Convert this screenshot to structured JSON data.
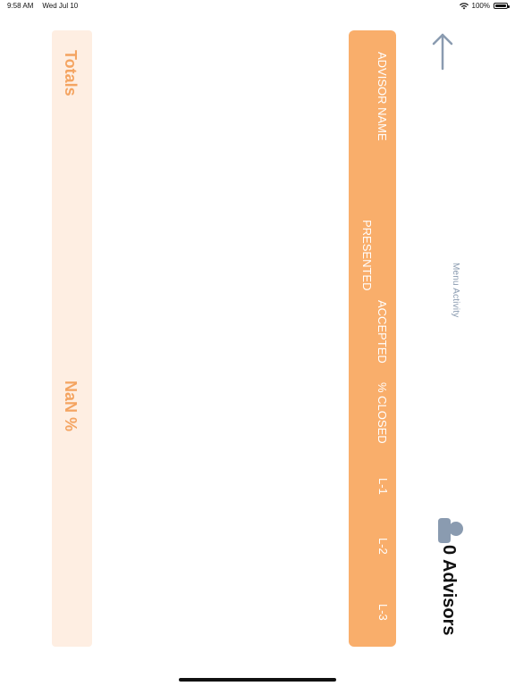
{
  "status_bar": {
    "time": "9:58 AM",
    "date": "Wed Jul 10",
    "battery": "100%"
  },
  "nav": {
    "back_icon": "arrow-up-icon",
    "menu_activity_label": "Menu Activity"
  },
  "advisors": {
    "icon": "advisor-people-icon",
    "count_label": "0 Advisors"
  },
  "table": {
    "columns": [
      "ADVISOR NAME",
      "PRESENTED",
      "ACCEPTED",
      "% CLOSED",
      "L-1",
      "L-2",
      "L-3"
    ],
    "rows": [],
    "totals": {
      "label": "Totals",
      "closed_percent": "NaN %"
    }
  },
  "colors": {
    "header_orange": "#f9ae6b",
    "totals_bg": "#feeee2",
    "totals_text": "#f4a461",
    "muted_blue": "#8a9bb0"
  }
}
